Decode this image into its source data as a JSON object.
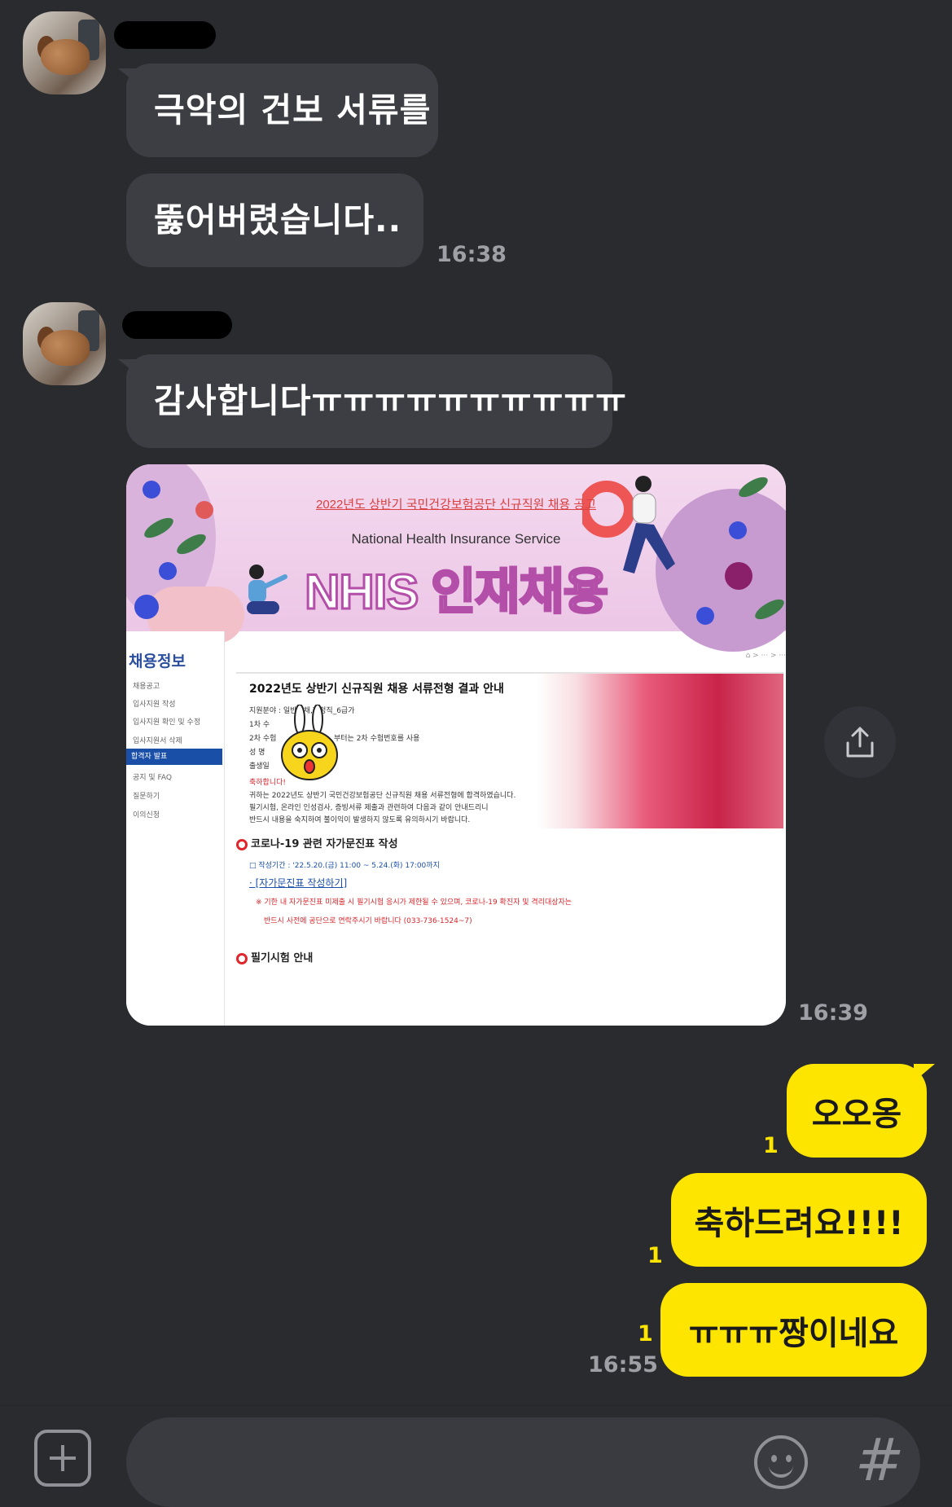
{
  "messages": [
    {
      "sender": "other",
      "text": "극악의 건보 서류를"
    },
    {
      "sender": "other",
      "text": "뚫어버렸습니다..",
      "time": "16:38"
    },
    {
      "sender": "other",
      "text": "감사합니다ㅠㅠㅠㅠㅠㅠㅠㅠㅠㅠ"
    },
    {
      "sender": "other",
      "type": "image",
      "time": "16:39"
    },
    {
      "sender": "me",
      "text": "오오옹",
      "unread": "1"
    },
    {
      "sender": "me",
      "text": "축하드려요!!!!",
      "unread": "1"
    },
    {
      "sender": "me",
      "text": "ㅠㅠㅠ짱이네요",
      "unread": "1",
      "time": "16:55"
    }
  ],
  "shared_image": {
    "banner_subtitle": "2022년도 상반기 국민건강보험공단 신규직원 채용 공고",
    "banner_english": "National Health Insurance Service",
    "banner_title": "NHIS 인재채용",
    "sidebar_heading": "채용정보",
    "sidebar_items": [
      "채용공고",
      "입사지원 작성",
      "입사지원 확인 및 수정",
      "입사지원서 삭제",
      "합격자 발표",
      "공지 및 FAQ",
      "질문하기",
      "이의신청"
    ],
    "active_item_index": 4,
    "notice_title": "2022년도 상반기 신규직원 채용 서류전형 결과 안내",
    "notice_lines": [
      "지원분야 : 일반공채,행정직_6급가",
      "1차 수",
      "2차 수험",
      "성 명",
      "출생일",
      "축하합니다!",
      "귀하는 2022년도 상반기 국민건강보험공단 신규직원 채용 서류전형에 합격하였습니다.",
      "필기시험, 온라인 인성검사, 증빙서류 제출과 관련하여 다음과 같이 안내드리니",
      "반드시 내용을 숙지하여 불이익이 발생하지 않도록 유의하시기 바랍니다."
    ],
    "notice_extra": "부터는 2차 수험번호를 사용",
    "section1_title": "코로나-19 관련 자가문진표 작성",
    "section1_period": "□ 작성기간 : '22.5.20.(금) 11:00 ~ 5.24.(화) 17:00까지",
    "section1_link": "· [자가문진표 작성하기]",
    "section1_warn1": "※ 기한 내 자가문진표 미제출 시 필기시험 응시가 제한될 수 있으며, 코로나-19 확진자 및 격리대상자는",
    "section1_warn2": "반드시 사전에 공단으로 연락주시기 바랍니다 (033-736-1524~7)",
    "section2_title": "필기시험 안내"
  },
  "icons": {
    "share": "share-icon",
    "attach": "plus-icon",
    "emoji": "emoji-icon",
    "hashtag": "hashtag-icon"
  },
  "colors": {
    "background": "#2a2b2e",
    "other_bubble": "#3d3e43",
    "my_bubble": "#fee500",
    "unread": "#fee500"
  }
}
